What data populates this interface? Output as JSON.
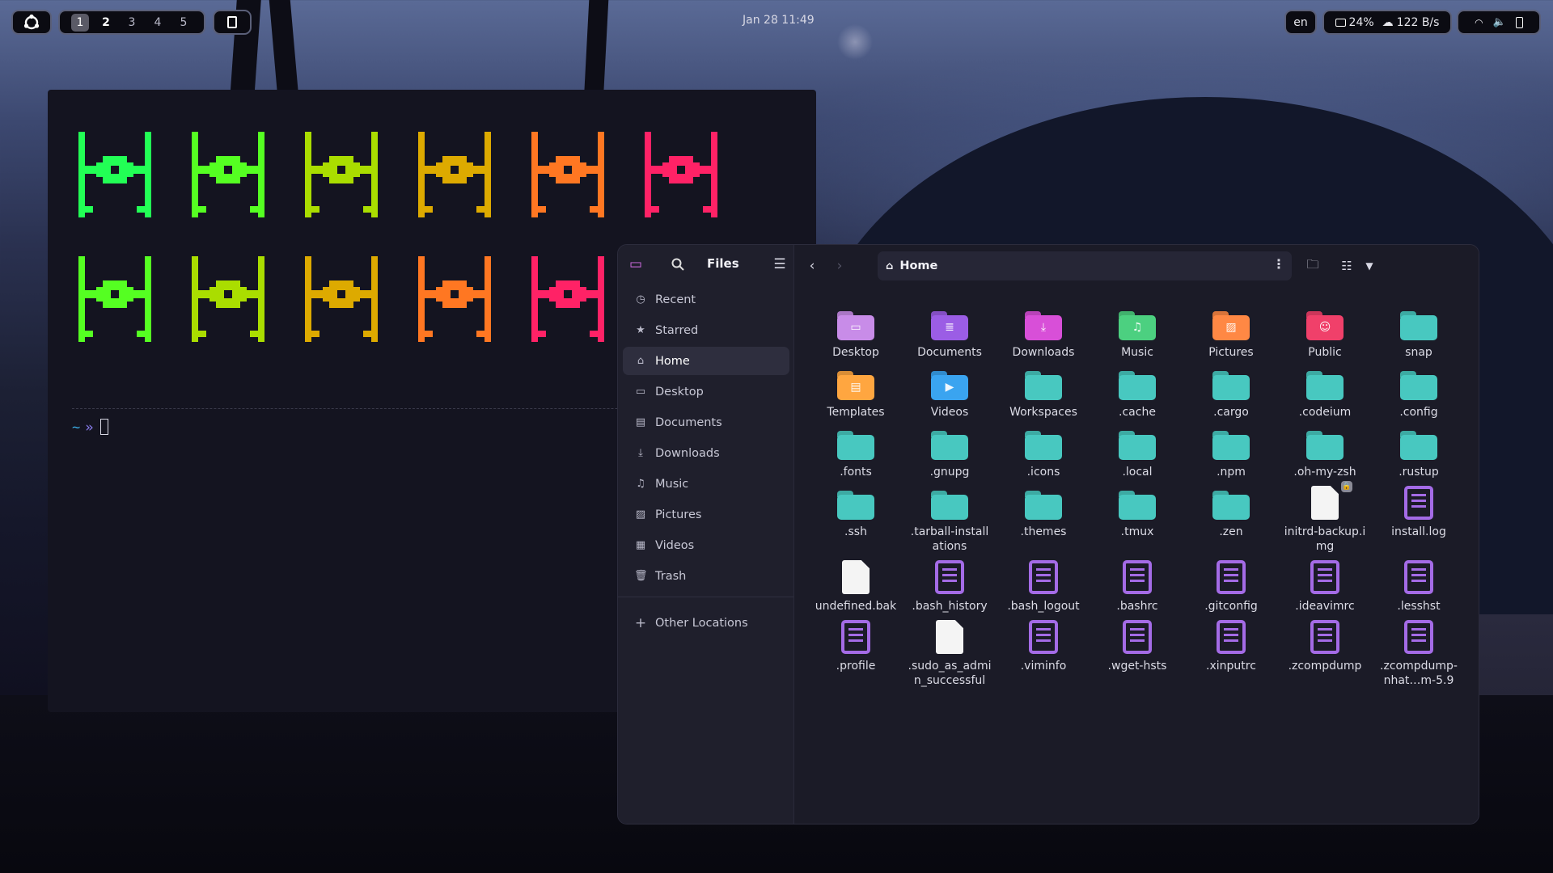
{
  "topbar": {
    "workspaces": [
      "1",
      "2",
      "3",
      "4",
      "5"
    ],
    "active_workspace": "1",
    "datetime": "Jan 28  11:49",
    "language": "en",
    "cpu": "24%",
    "network": "122 B/s"
  },
  "terminal": {
    "prompt_tilde": "~",
    "prompt_arrow": "»",
    "colors": [
      "#22ff55",
      "#55ff22",
      "#aadd00",
      "#ddaa00",
      "#ff7722",
      "#ff2266"
    ]
  },
  "files": {
    "title": "Files",
    "path": "Home",
    "sidebar": [
      {
        "label": "Recent",
        "icon": "clock-icon"
      },
      {
        "label": "Starred",
        "icon": "star-icon"
      },
      {
        "label": "Home",
        "icon": "home-icon",
        "active": true
      },
      {
        "label": "Desktop",
        "icon": "desktop-icon"
      },
      {
        "label": "Documents",
        "icon": "document-icon"
      },
      {
        "label": "Downloads",
        "icon": "download-icon"
      },
      {
        "label": "Music",
        "icon": "music-icon"
      },
      {
        "label": "Pictures",
        "icon": "picture-icon"
      },
      {
        "label": "Videos",
        "icon": "film-icon"
      },
      {
        "label": "Trash",
        "icon": "trash-icon"
      }
    ],
    "other_locations": "Other Locations",
    "items": [
      {
        "name": "Desktop",
        "kind": "folder",
        "color": "#c88ce8",
        "glyph": "▭"
      },
      {
        "name": "Documents",
        "kind": "folder",
        "color": "#9b5de5",
        "glyph": "≣"
      },
      {
        "name": "Downloads",
        "kind": "folder",
        "color": "#d84fd8",
        "glyph": "⤓"
      },
      {
        "name": "Music",
        "kind": "folder",
        "color": "#4cd080",
        "glyph": "♫"
      },
      {
        "name": "Pictures",
        "kind": "folder",
        "color": "#ff8844",
        "glyph": "▨"
      },
      {
        "name": "Public",
        "kind": "folder",
        "color": "#f0406a",
        "glyph": "☺"
      },
      {
        "name": "snap",
        "kind": "folder",
        "color": "#48c8c0",
        "glyph": ""
      },
      {
        "name": "Templates",
        "kind": "folder",
        "color": "#ffa640",
        "glyph": "▤"
      },
      {
        "name": "Videos",
        "kind": "folder",
        "color": "#3aa4f0",
        "glyph": "▶"
      },
      {
        "name": "Workspaces",
        "kind": "folder",
        "color": "#48c8c0",
        "glyph": ""
      },
      {
        "name": ".cache",
        "kind": "folder",
        "color": "#48c8c0",
        "glyph": ""
      },
      {
        "name": ".cargo",
        "kind": "folder",
        "color": "#48c8c0",
        "glyph": ""
      },
      {
        "name": ".codeium",
        "kind": "folder",
        "color": "#48c8c0",
        "glyph": ""
      },
      {
        "name": ".config",
        "kind": "folder",
        "color": "#48c8c0",
        "glyph": ""
      },
      {
        "name": ".fonts",
        "kind": "folder",
        "color": "#48c8c0",
        "glyph": ""
      },
      {
        "name": ".gnupg",
        "kind": "folder",
        "color": "#48c8c0",
        "glyph": ""
      },
      {
        "name": ".icons",
        "kind": "folder",
        "color": "#48c8c0",
        "glyph": ""
      },
      {
        "name": ".local",
        "kind": "folder",
        "color": "#48c8c0",
        "glyph": ""
      },
      {
        "name": ".npm",
        "kind": "folder",
        "color": "#48c8c0",
        "glyph": ""
      },
      {
        "name": ".oh-my-zsh",
        "kind": "folder",
        "color": "#48c8c0",
        "glyph": ""
      },
      {
        "name": ".rustup",
        "kind": "folder",
        "color": "#48c8c0",
        "glyph": ""
      },
      {
        "name": ".ssh",
        "kind": "folder",
        "color": "#48c8c0",
        "glyph": ""
      },
      {
        "name": ".tarball-installations",
        "kind": "folder",
        "color": "#48c8c0",
        "glyph": ""
      },
      {
        "name": ".themes",
        "kind": "folder",
        "color": "#48c8c0",
        "glyph": ""
      },
      {
        "name": ".tmux",
        "kind": "folder",
        "color": "#48c8c0",
        "glyph": ""
      },
      {
        "name": ".zen",
        "kind": "folder",
        "color": "#48c8c0",
        "glyph": ""
      },
      {
        "name": "initrd-backup.img",
        "kind": "blank",
        "locked": true
      },
      {
        "name": "install.log",
        "kind": "doc"
      },
      {
        "name": "undefined.bak",
        "kind": "blank"
      },
      {
        "name": ".bash_history",
        "kind": "doc"
      },
      {
        "name": ".bash_logout",
        "kind": "doc"
      },
      {
        "name": ".bashrc",
        "kind": "doc"
      },
      {
        "name": ".gitconfig",
        "kind": "doc"
      },
      {
        "name": ".ideavimrc",
        "kind": "doc"
      },
      {
        "name": ".lesshst",
        "kind": "doc"
      },
      {
        "name": ".profile",
        "kind": "doc"
      },
      {
        "name": ".sudo_as_admin_successful",
        "kind": "blank"
      },
      {
        "name": ".viminfo",
        "kind": "doc"
      },
      {
        "name": ".wget-hsts",
        "kind": "doc"
      },
      {
        "name": ".xinputrc",
        "kind": "doc"
      },
      {
        "name": ".zcompdump",
        "kind": "doc"
      },
      {
        "name": ".zcompdump-nhat…m-5.9",
        "kind": "doc"
      }
    ]
  }
}
